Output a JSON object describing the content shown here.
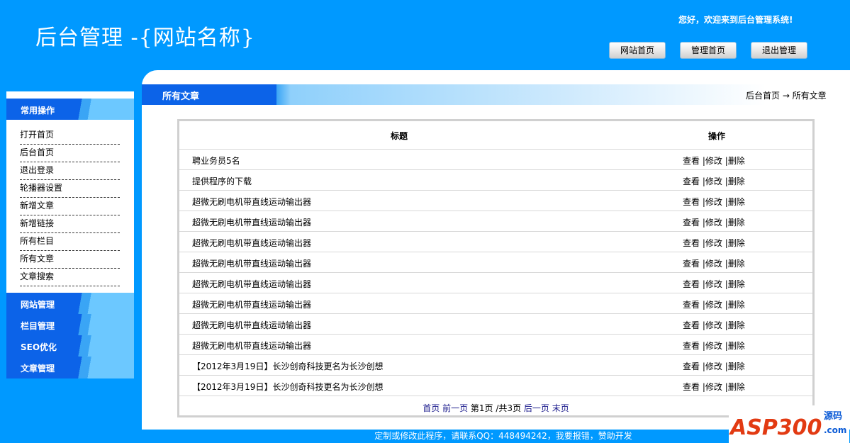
{
  "header": {
    "title": "后台管理  -{网站名称}",
    "welcome": "您好，欢迎来到后台管理系统!",
    "buttons": [
      "网站首页",
      "管理首页",
      "退出管理"
    ]
  },
  "sidebar": {
    "common_title": "常用操作",
    "items": [
      "打开首页",
      "后台首页",
      "退出登录",
      "轮播器设置",
      "新增文章",
      "新增链接",
      "所有栏目",
      "所有文章",
      "文章搜索"
    ],
    "groups": [
      "网站管理",
      "栏目管理",
      "SEO优化",
      "文章管理"
    ]
  },
  "page": {
    "title": "所有文章",
    "breadcrumb": "后台首页 → 所有文章"
  },
  "table": {
    "headers": [
      "标题",
      "操作"
    ],
    "rows": [
      "聘业务员5名",
      "提供程序的下载",
      "超微无刷电机带直线运动输出器",
      "超微无刷电机带直线运动输出器",
      "超微无刷电机带直线运动输出器",
      "超微无刷电机带直线运动输出器",
      "超微无刷电机带直线运动输出器",
      "超微无刷电机带直线运动输出器",
      "超微无刷电机带直线运动输出器",
      "超微无刷电机带直线运动输出器",
      "【2012年3月19日】长沙创奇科技更名为长沙创想",
      "【2012年3月19日】长沙创奇科技更名为长沙创想"
    ],
    "actions": {
      "view": "查看",
      "edit": "|修改",
      "delete": "|删除"
    }
  },
  "pager": {
    "first": "首页",
    "prev": "前一页",
    "current": "第1页",
    "total": "/共3页",
    "next": "后一页",
    "last": "末页"
  },
  "footer": {
    "text": "定制或修改此程序，请联系QQ：448494242，我要报错，赞助开发"
  },
  "watermark": {
    "text": "ASP300",
    "sub": "源码",
    "domain": ".com"
  }
}
